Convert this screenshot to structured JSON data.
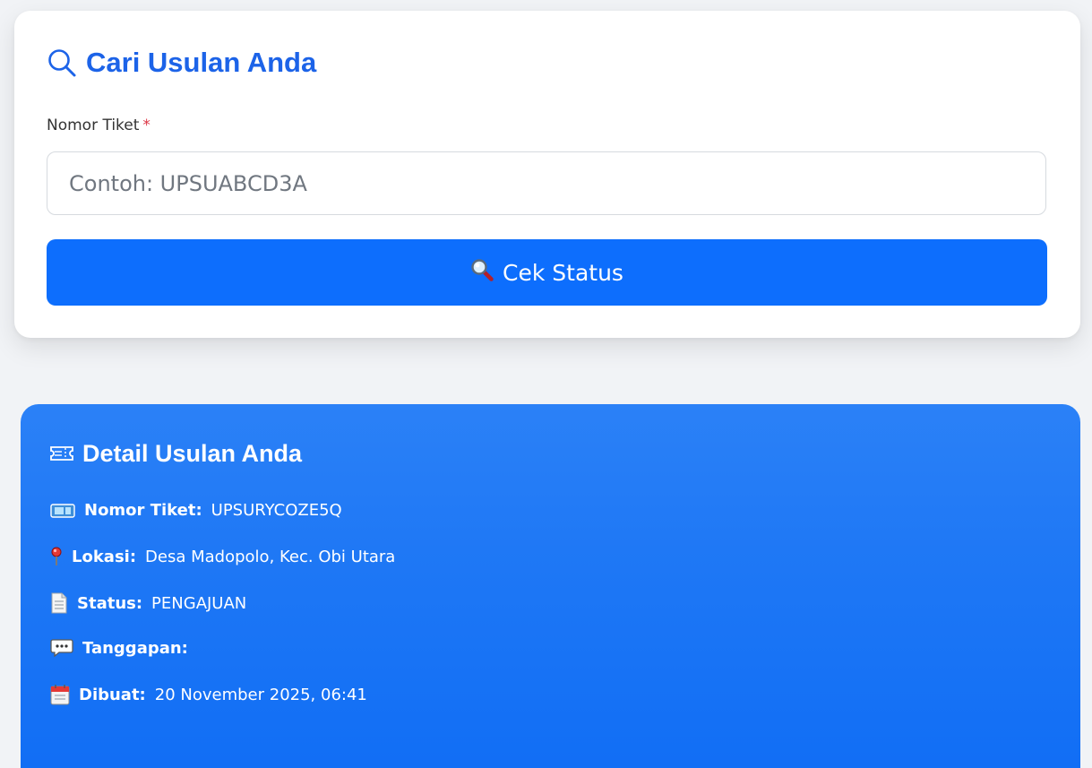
{
  "search": {
    "title": "Cari Usulan Anda",
    "ticket_label": "Nomor Tiket",
    "required_mark": "*",
    "placeholder": "Contoh: UPSUABCD3A",
    "button_label": "Cek Status",
    "accent_color": "#0d6efd"
  },
  "detail": {
    "title": "Detail Usulan Anda",
    "ticket": {
      "label": "Nomor Tiket:",
      "value": "UPSURYCOZE5Q",
      "icon": "ticket-icon"
    },
    "location": {
      "label": "Lokasi:",
      "value": "Desa Madopolo, Kec. Obi Utara",
      "icon": "pin-icon"
    },
    "status": {
      "label": "Status:",
      "value": "PENGAJUAN",
      "icon": "document-icon"
    },
    "response": {
      "label": "Tanggapan:",
      "value": "",
      "icon": "speech-bubble-icon"
    },
    "created": {
      "label": "Dibuat:",
      "value": "20 November 2025, 06:41",
      "icon": "calendar-icon"
    }
  }
}
